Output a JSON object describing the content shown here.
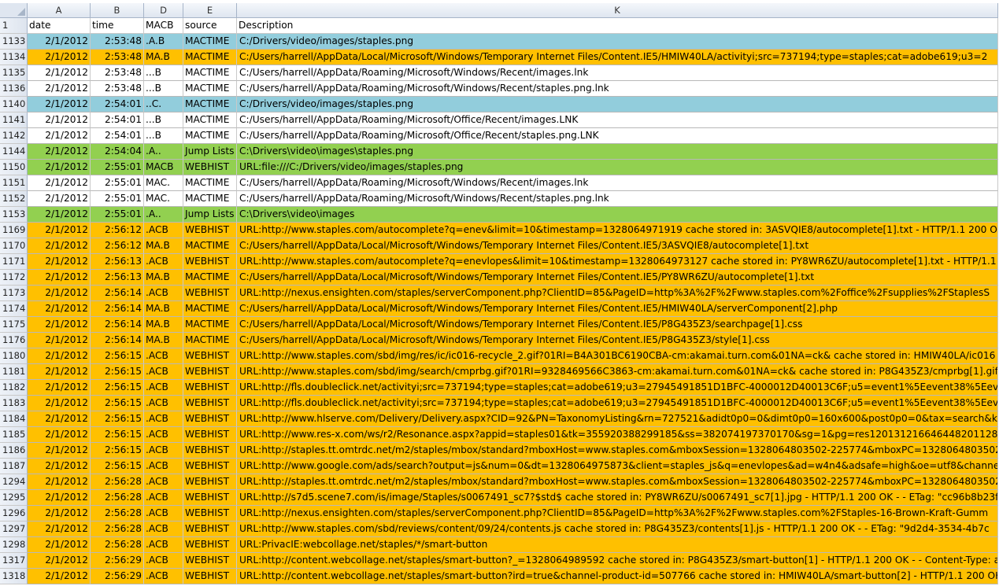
{
  "columns": {
    "row_header": "",
    "A": "A",
    "B": "B",
    "D": "D",
    "E": "E",
    "K": "K"
  },
  "header_row": {
    "num": "1",
    "date": "date",
    "time": "time",
    "macb": "MACB",
    "source": "source",
    "description": "Description"
  },
  "colors": {
    "white": "#ffffff",
    "blue": "#92cddc",
    "orange": "#ffc000",
    "green": "#92d050"
  },
  "rows": [
    {
      "num": "1133",
      "date": "2/1/2012",
      "time": "2:53:48",
      "macb": ".A.B",
      "source": "MACTIME",
      "description": "C:/Drivers/video/images/staples.png",
      "fill": "blue"
    },
    {
      "num": "1134",
      "date": "2/1/2012",
      "time": "2:53:48",
      "macb": "MA.B",
      "source": "MACTIME",
      "description": "C:/Users/harrell/AppData/Local/Microsoft/Windows/Temporary Internet Files/Content.IE5/HMIW40LA/activityi;src=737194;type=staples;cat=adobe619;u3=2",
      "fill": "orange"
    },
    {
      "num": "1135",
      "date": "2/1/2012",
      "time": "2:53:48",
      "macb": "...B",
      "source": "MACTIME",
      "description": "C:/Users/harrell/AppData/Roaming/Microsoft/Windows/Recent/images.lnk",
      "fill": "white"
    },
    {
      "num": "1136",
      "date": "2/1/2012",
      "time": "2:53:48",
      "macb": "...B",
      "source": "MACTIME",
      "description": "C:/Users/harrell/AppData/Roaming/Microsoft/Windows/Recent/staples.png.lnk",
      "fill": "white"
    },
    {
      "num": "1140",
      "date": "2/1/2012",
      "time": "2:54:01",
      "macb": "..C.",
      "source": "MACTIME",
      "description": "C:/Drivers/video/images/staples.png",
      "fill": "blue"
    },
    {
      "num": "1141",
      "date": "2/1/2012",
      "time": "2:54:01",
      "macb": "...B",
      "source": "MACTIME",
      "description": "C:/Users/harrell/AppData/Roaming/Microsoft/Office/Recent/images.LNK",
      "fill": "white"
    },
    {
      "num": "1142",
      "date": "2/1/2012",
      "time": "2:54:01",
      "macb": "...B",
      "source": "MACTIME",
      "description": "C:/Users/harrell/AppData/Roaming/Microsoft/Office/Recent/staples.png.LNK",
      "fill": "white"
    },
    {
      "num": "1144",
      "date": "2/1/2012",
      "time": "2:54:04",
      "macb": ".A..",
      "source": "Jump Lists",
      "description": "C:\\Drivers\\video\\images\\staples.png",
      "fill": "green"
    },
    {
      "num": "1150",
      "date": "2/1/2012",
      "time": "2:55:01",
      "macb": "MACB",
      "source": "WEBHIST",
      "description": "URL:file:///C:/Drivers/video/images/staples.png",
      "fill": "green"
    },
    {
      "num": "1151",
      "date": "2/1/2012",
      "time": "2:55:01",
      "macb": "MAC.",
      "source": "MACTIME",
      "description": "C:/Users/harrell/AppData/Roaming/Microsoft/Windows/Recent/images.lnk",
      "fill": "white"
    },
    {
      "num": "1152",
      "date": "2/1/2012",
      "time": "2:55:01",
      "macb": "MAC.",
      "source": "MACTIME",
      "description": "C:/Users/harrell/AppData/Roaming/Microsoft/Windows/Recent/staples.png.lnk",
      "fill": "white"
    },
    {
      "num": "1153",
      "date": "2/1/2012",
      "time": "2:55:01",
      "macb": ".A..",
      "source": "Jump Lists",
      "description": "C:\\Drivers\\video\\images",
      "fill": "green"
    },
    {
      "num": "1169",
      "date": "2/1/2012",
      "time": "2:56:12",
      "macb": ".ACB",
      "source": "WEBHIST",
      "description": "URL:http://www.staples.com/autocomplete?q=enev&limit=10&timestamp=1328064971919 cache stored in: 3ASVQIE8/autocomplete[1].txt - HTTP/1.1 200 OK",
      "fill": "orange"
    },
    {
      "num": "1170",
      "date": "2/1/2012",
      "time": "2:56:12",
      "macb": "MA.B",
      "source": "MACTIME",
      "description": "C:/Users/harrell/AppData/Local/Microsoft/Windows/Temporary Internet Files/Content.IE5/3ASVQIE8/autocomplete[1].txt",
      "fill": "orange"
    },
    {
      "num": "1171",
      "date": "2/1/2012",
      "time": "2:56:13",
      "macb": ".ACB",
      "source": "WEBHIST",
      "description": "URL:http://www.staples.com/autocomplete?q=enevlopes&limit=10&timestamp=1328064973127 cache stored in: PY8WR6ZU/autocomplete[1].txt - HTTP/1.1",
      "fill": "orange"
    },
    {
      "num": "1172",
      "date": "2/1/2012",
      "time": "2:56:13",
      "macb": "MA.B",
      "source": "MACTIME",
      "description": "C:/Users/harrell/AppData/Local/Microsoft/Windows/Temporary Internet Files/Content.IE5/PY8WR6ZU/autocomplete[1].txt",
      "fill": "orange"
    },
    {
      "num": "1173",
      "date": "2/1/2012",
      "time": "2:56:14",
      "macb": ".ACB",
      "source": "WEBHIST",
      "description": "URL:http://nexus.ensighten.com/staples/serverComponent.php?ClientID=85&PageID=http%3A%2F%2Fwww.staples.com%2Foffice%2Fsupplies%2FStaplesS",
      "fill": "orange"
    },
    {
      "num": "1174",
      "date": "2/1/2012",
      "time": "2:56:14",
      "macb": "MA.B",
      "source": "MACTIME",
      "description": "C:/Users/harrell/AppData/Local/Microsoft/Windows/Temporary Internet Files/Content.IE5/HMIW40LA/serverComponent[2].php",
      "fill": "orange"
    },
    {
      "num": "1175",
      "date": "2/1/2012",
      "time": "2:56:14",
      "macb": "MA.B",
      "source": "MACTIME",
      "description": "C:/Users/harrell/AppData/Local/Microsoft/Windows/Temporary Internet Files/Content.IE5/P8G435Z3/searchpage[1].css",
      "fill": "orange"
    },
    {
      "num": "1176",
      "date": "2/1/2012",
      "time": "2:56:14",
      "macb": "MA.B",
      "source": "MACTIME",
      "description": "C:/Users/harrell/AppData/Local/Microsoft/Windows/Temporary Internet Files/Content.IE5/P8G435Z3/style[1].css",
      "fill": "orange"
    },
    {
      "num": "1180",
      "date": "2/1/2012",
      "time": "2:56:15",
      "macb": ".ACB",
      "source": "WEBHIST",
      "description": "URL:http://www.staples.com/sbd/img/res/ic/ic016-recycle_2.gif?01RI=B4A301BC6190CBA-cm:akamai.turn.com&01NA=ck& cache stored in: HMIW40LA/ic016",
      "fill": "orange"
    },
    {
      "num": "1181",
      "date": "2/1/2012",
      "time": "2:56:15",
      "macb": ".ACB",
      "source": "WEBHIST",
      "description": "URL:http://www.staples.com/sbd/img/search/cmprbg.gif?01RI=9328469566C3863-cm:akamai.turn.com&01NA=ck& cache stored in: P8G435Z3/cmprbg[1].gif -",
      "fill": "orange"
    },
    {
      "num": "1182",
      "date": "2/1/2012",
      "time": "2:56:15",
      "macb": ".ACB",
      "source": "WEBHIST",
      "description": "URL:http://fls.doubleclick.net/activityi;src=737194;type=staples;cat=adobe619;u3=27945491851D1BFC-4000012D40013C6F;u5=event1%5Eevent38%5Eevent73",
      "fill": "orange"
    },
    {
      "num": "1183",
      "date": "2/1/2012",
      "time": "2:56:15",
      "macb": ".ACB",
      "source": "WEBHIST",
      "description": "URL:http://fls.doubleclick.net/activityi;src=737194;type=staples;cat=adobe619;u3=27945491851D1BFC-4000012D40013C6F;u5=event1%5Eevent38%5Eevent73",
      "fill": "orange"
    },
    {
      "num": "1184",
      "date": "2/1/2012",
      "time": "2:56:15",
      "macb": ".ACB",
      "source": "WEBHIST",
      "description": "URL:http://www.hlserve.com/Delivery/Delivery.aspx?CID=92&PN=TaxonomyListing&rn=727521&adidt0p0=0&dimt0p0=160x600&post0p0=0&tax=search&kw",
      "fill": "orange"
    },
    {
      "num": "1185",
      "date": "2/1/2012",
      "time": "2:56:15",
      "macb": ".ACB",
      "source": "WEBHIST",
      "description": "URL:http://www.res-x.com/ws/r2/Resonance.aspx?appid=staples01&tk=355920388299185&ss=382074197370170&sg=1&pg=res120131216646448201128158bx",
      "fill": "orange"
    },
    {
      "num": "1186",
      "date": "2/1/2012",
      "time": "2:56:15",
      "macb": ".ACB",
      "source": "WEBHIST",
      "description": "URL:http://staples.tt.omtrdc.net/m2/staples/mbox/standard?mboxHost=www.staples.com&mboxSession=1328064803502-225774&mboxPC=1328064803502-",
      "fill": "orange"
    },
    {
      "num": "1187",
      "date": "2/1/2012",
      "time": "2:56:15",
      "macb": ".ACB",
      "source": "WEBHIST",
      "description": "URL:http://www.google.com/ads/search?output=js&num=0&dt=1328064975873&client=staples_js&q=enevlopes&ad=w4n4&adsafe=high&oe=utf8&channel=",
      "fill": "orange"
    },
    {
      "num": "1294",
      "date": "2/1/2012",
      "time": "2:56:28",
      "macb": ".ACB",
      "source": "WEBHIST",
      "description": "URL:http://staples.tt.omtrdc.net/m2/staples/mbox/standard?mboxHost=www.staples.com&mboxSession=1328064803502-225774&mboxPC=1328064803502-",
      "fill": "orange"
    },
    {
      "num": "1295",
      "date": "2/1/2012",
      "time": "2:56:28",
      "macb": ".ACB",
      "source": "WEBHIST",
      "description": "URL:http://s7d5.scene7.com/is/image/Staples/s0067491_sc7?$std$ cache stored in: PY8WR6ZU/s0067491_sc7[1].jpg - HTTP/1.1 200 OK -  - ETag: \"cc96b8b23f81",
      "fill": "orange"
    },
    {
      "num": "1296",
      "date": "2/1/2012",
      "time": "2:56:28",
      "macb": ".ACB",
      "source": "WEBHIST",
      "description": "URL:http://nexus.ensighten.com/staples/serverComponent.php?ClientID=85&PageID=http%3A%2F%2Fwww.staples.com%2FStaples-16-Brown-Kraft-Gumm",
      "fill": "orange"
    },
    {
      "num": "1297",
      "date": "2/1/2012",
      "time": "2:56:28",
      "macb": ".ACB",
      "source": "WEBHIST",
      "description": "URL:http://www.staples.com/sbd/reviews/content/09/24/contents.js cache stored in: P8G435Z3/contents[1].js - HTTP/1.1 200 OK -  - ETag: \"9d2d4-3534-4b7c",
      "fill": "orange"
    },
    {
      "num": "1298",
      "date": "2/1/2012",
      "time": "2:56:28",
      "macb": ".ACB",
      "source": "WEBHIST",
      "description": "URL:PrivacIE:webcollage.net/staples/*/smart-button",
      "fill": "orange"
    },
    {
      "num": "1317",
      "date": "2/1/2012",
      "time": "2:56:29",
      "macb": ".ACB",
      "source": "WEBHIST",
      "description": "URL:http://content.webcollage.net/staples/smart-button?_=1328064989592 cache stored in: P8G435Z3/smart-button[1] - HTTP/1.1 200 OK -  - Content-Type: a",
      "fill": "orange"
    },
    {
      "num": "1318",
      "date": "2/1/2012",
      "time": "2:56:29",
      "macb": ".ACB",
      "source": "WEBHIST",
      "description": "URL:http://content.webcollage.net/staples/smart-button?ird=true&channel-product-id=507766 cache stored in: HMIW40LA/smart-button[2] - HTTP/1.1 200 OK -",
      "fill": "orange"
    }
  ]
}
